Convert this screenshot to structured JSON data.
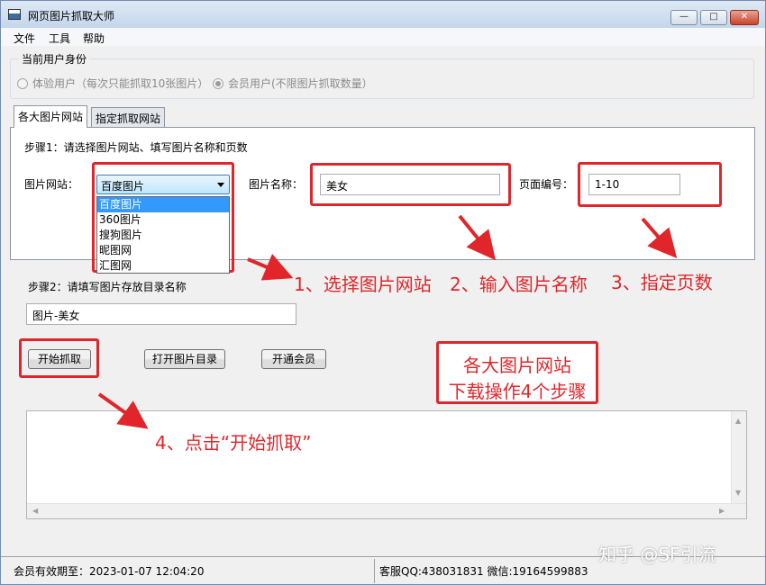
{
  "window": {
    "title": "网页图片抓取大师"
  },
  "menu": {
    "file": "文件",
    "tools": "工具",
    "help": "帮助"
  },
  "identity": {
    "group_title": "当前用户身份",
    "trial_label": "体验用户（每次只能抓取10张图片）",
    "member_label": "会员用户(不限图片抓取数量）",
    "selected": "member"
  },
  "tabs": [
    {
      "label": "各大图片网站",
      "active": true
    },
    {
      "label": "指定抓取网站",
      "active": false
    }
  ],
  "step1": {
    "title": "步骤1：请选择图片网站、填写图片名称和页数",
    "site_label": "图片网站：",
    "site_value": "百度图片",
    "site_options": [
      "百度图片",
      "360图片",
      "搜狗图片",
      "昵图网",
      "汇图网"
    ],
    "name_label": "图片名称：",
    "name_value": "美女",
    "page_label": "页面编号：",
    "page_value": "1-10"
  },
  "step2": {
    "title": "步骤2：请填写图片存放目录名称",
    "dir_value": "图片-美女"
  },
  "buttons": {
    "start": "开始抓取",
    "open_dir": "打开图片目录",
    "vip": "开通会员"
  },
  "status": {
    "expiry": "会员有效期至：2023-01-07 12:04:20",
    "contact": "客服QQ:438031831 微信:19164599883"
  },
  "annotations": {
    "a1": "1、选择图片网站",
    "a2": "2、输入图片名称",
    "a3": "3、指定页数",
    "a4": "4、点击“开始抓取”",
    "summary_line1": "各大图片网站",
    "summary_line2": "下载操作4个步骤"
  },
  "watermark": "知乎 @SF引流",
  "colors": {
    "annotation_red": "#e0262b",
    "selection_blue": "#3399ff"
  }
}
